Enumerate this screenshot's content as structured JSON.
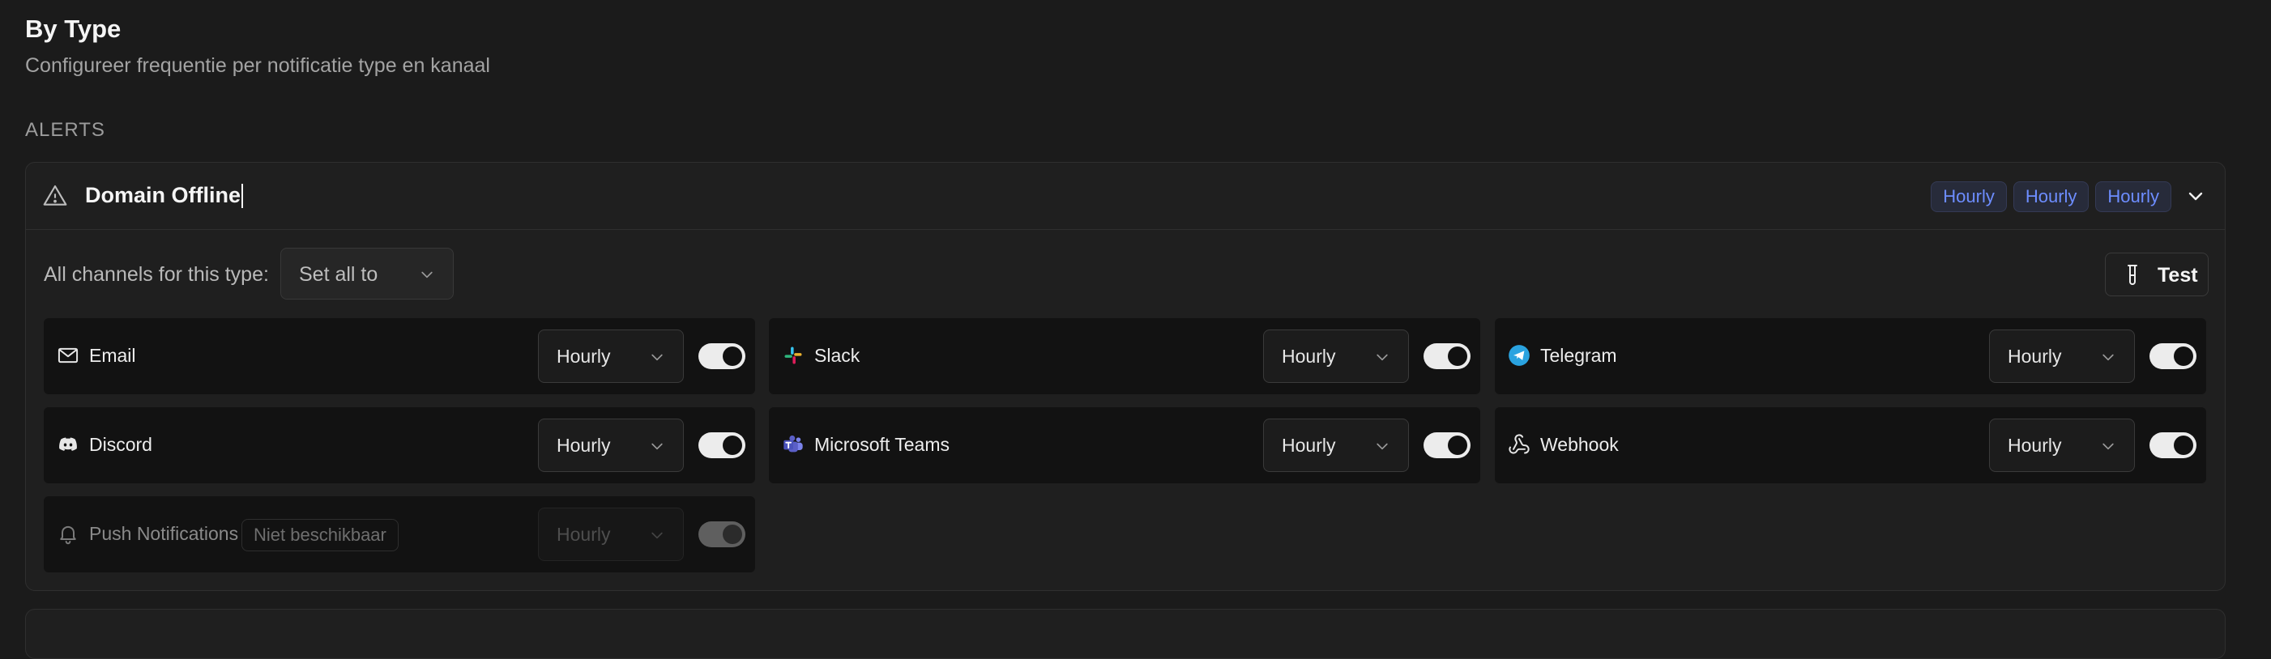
{
  "header": {
    "title": "By Type",
    "subtitle": "Configureer frequentie per notificatie type en kanaal"
  },
  "section": {
    "label": "ALERTS"
  },
  "alert_type": {
    "title": "Domain Offline",
    "badges": [
      "Hourly",
      "Hourly",
      "Hourly"
    ],
    "all_channels_label": "All channels for this type:",
    "set_all_placeholder": "Set all to",
    "test_label": "Test",
    "channels": [
      {
        "name": "Email",
        "icon": "mail-icon",
        "frequency": "Hourly",
        "enabled": true
      },
      {
        "name": "Slack",
        "icon": "slack-icon",
        "frequency": "Hourly",
        "enabled": true
      },
      {
        "name": "Telegram",
        "icon": "telegram-icon",
        "frequency": "Hourly",
        "enabled": true
      },
      {
        "name": "Discord",
        "icon": "discord-icon",
        "frequency": "Hourly",
        "enabled": true
      },
      {
        "name": "Microsoft Teams",
        "icon": "teams-icon",
        "frequency": "Hourly",
        "enabled": true
      },
      {
        "name": "Webhook",
        "icon": "webhook-icon",
        "frequency": "Hourly",
        "enabled": true
      },
      {
        "name": "Push Notifications",
        "icon": "bell-icon",
        "frequency": "Hourly",
        "enabled": true,
        "disabled": true,
        "status_badge": "Niet beschikbaar"
      }
    ]
  },
  "colors": {
    "background": "#1b1b1b",
    "card": "#1f1f1f",
    "channel_row": "#121212",
    "badge_text": "#6d8dff",
    "telegram": "#2aa3e0",
    "teams": "#6b6fd8"
  }
}
